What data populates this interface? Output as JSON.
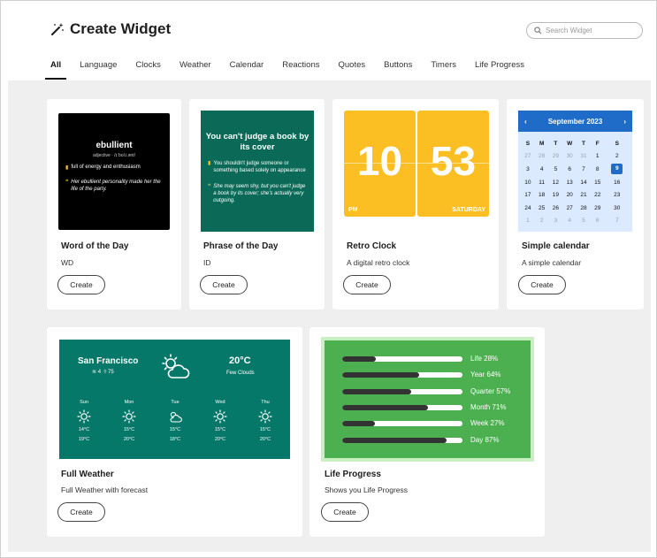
{
  "header": {
    "title": "Create Widget"
  },
  "search": {
    "placeholder": "Search Widget"
  },
  "tabs": [
    "All",
    "Language",
    "Clocks",
    "Weather",
    "Calendar",
    "Reactions",
    "Quotes",
    "Buttons",
    "Timers",
    "Life Progress"
  ],
  "active_tab": "All",
  "cards": {
    "word": {
      "title": "Word of the Day",
      "subtitle": "WD",
      "button": "Create"
    },
    "phrase": {
      "title": "Phrase of the Day",
      "subtitle": "ID",
      "button": "Create"
    },
    "clock": {
      "title": "Retro Clock",
      "subtitle": "A digital retro clock",
      "button": "Create"
    },
    "calendar": {
      "title": "Simple calendar",
      "subtitle": "A simple calendar",
      "button": "Create"
    },
    "weather": {
      "title": "Full Weather",
      "subtitle": "Full Weather with forecast",
      "button": "Create"
    },
    "life": {
      "title": "Life Progress",
      "subtitle": "Shows you Life Progress",
      "button": "Create"
    }
  },
  "word_preview": {
    "word": "ebullient",
    "pronunciation": "adjective · /ɪˈbʊl.i.ənt/",
    "definition": "full of energy and enthusiasm",
    "example": "Her ebullient personality made her the life of the party."
  },
  "phrase_preview": {
    "phrase": "You can't judge a book by its cover",
    "definition": "You shouldn't judge someone or something based solely on appearance",
    "example": "She may seem shy, but you can't judge a book by its cover; she's actually very outgoing."
  },
  "clock_preview": {
    "hours": "10",
    "minutes": "53",
    "period": "PM",
    "day": "SATURDAY",
    "color": "#fbbf24"
  },
  "calendar_preview": {
    "month": "September 2023",
    "prev_icon": "‹",
    "next_icon": "›",
    "dow": [
      "S",
      "M",
      "T",
      "W",
      "T",
      "F",
      "S"
    ],
    "weeks": [
      [
        {
          "d": "27",
          "m": true
        },
        {
          "d": "28",
          "m": true
        },
        {
          "d": "29",
          "m": true
        },
        {
          "d": "30",
          "m": true
        },
        {
          "d": "31",
          "m": true
        },
        {
          "d": "1"
        },
        {
          "d": "2"
        }
      ],
      [
        {
          "d": "3"
        },
        {
          "d": "4"
        },
        {
          "d": "5"
        },
        {
          "d": "6"
        },
        {
          "d": "7"
        },
        {
          "d": "8"
        },
        {
          "d": "9",
          "t": true
        }
      ],
      [
        {
          "d": "10"
        },
        {
          "d": "11"
        },
        {
          "d": "12"
        },
        {
          "d": "13"
        },
        {
          "d": "14"
        },
        {
          "d": "15"
        },
        {
          "d": "16"
        }
      ],
      [
        {
          "d": "17"
        },
        {
          "d": "18"
        },
        {
          "d": "19"
        },
        {
          "d": "20"
        },
        {
          "d": "21"
        },
        {
          "d": "22"
        },
        {
          "d": "23"
        }
      ],
      [
        {
          "d": "24"
        },
        {
          "d": "25"
        },
        {
          "d": "26"
        },
        {
          "d": "27"
        },
        {
          "d": "28"
        },
        {
          "d": "29"
        },
        {
          "d": "30"
        }
      ],
      [
        {
          "d": "1",
          "m": true
        },
        {
          "d": "2",
          "m": true
        },
        {
          "d": "3",
          "m": true
        },
        {
          "d": "4",
          "m": true
        },
        {
          "d": "5",
          "m": true
        },
        {
          "d": "6",
          "m": true
        },
        {
          "d": "7",
          "m": true
        }
      ]
    ],
    "accent": "#1e6cc7"
  },
  "weather_preview": {
    "city": "San Francisco",
    "wind": "4",
    "humidity": "75",
    "temp": "20°C",
    "condition": "Few Clouds",
    "forecast": [
      {
        "day": "Sun",
        "icon": "sun-icon",
        "hi": "14°C",
        "lo": "19°C"
      },
      {
        "day": "Mon",
        "icon": "sun-icon",
        "hi": "15°C",
        "lo": "20°C"
      },
      {
        "day": "Tue",
        "icon": "cloud-icon",
        "hi": "15°C",
        "lo": "18°C"
      },
      {
        "day": "Wed",
        "icon": "sun-icon",
        "hi": "15°C",
        "lo": "20°C"
      },
      {
        "day": "Thu",
        "icon": "sun-icon",
        "hi": "15°C",
        "lo": "20°C"
      }
    ]
  },
  "life_preview": {
    "rows": [
      {
        "label": "Life 28%",
        "value": 28
      },
      {
        "label": "Year 64%",
        "value": 64
      },
      {
        "label": "Quarter 57%",
        "value": 57
      },
      {
        "label": "Month 71%",
        "value": 71
      },
      {
        "label": "Week 27%",
        "value": 27
      },
      {
        "label": "Day 87%",
        "value": 87
      }
    ]
  }
}
